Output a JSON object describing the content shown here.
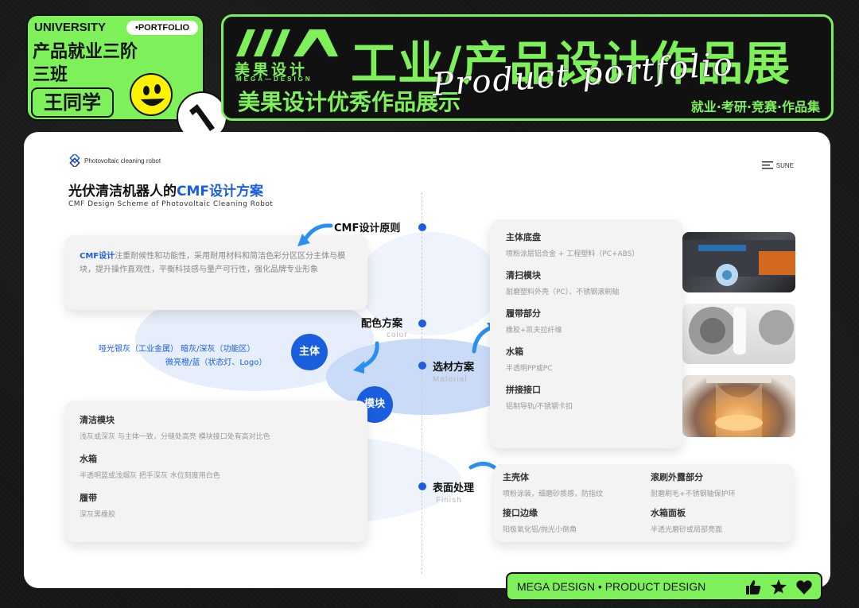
{
  "badge": {
    "university": "UNIVERSITY",
    "portfolio": "•PORTFOLIO",
    "line1": "产品就业三阶",
    "line2": "三班",
    "name": "王同学"
  },
  "banner": {
    "brand_cn": "美果设计",
    "brand_en": "MEGA—DESIGN",
    "title": "工业/产品设计作品展",
    "subtitle": "美果设计优秀作品展示",
    "script": "Product portfolio",
    "tags": "就业·考研·竞赛·作品集"
  },
  "card": {
    "logo_text": "Photovoltaic cleaning robot",
    "sune": "SUNE",
    "title_prefix": "光伏清洁机器人的",
    "title_highlight": "CMF设计方案",
    "subtitle": "CMF Design Scheme of Photovoltaic Cleaning Robot"
  },
  "nodes": {
    "principle": "CMF设计原则",
    "color": "配色方案",
    "color_en": "color",
    "material": "选材方案",
    "material_en": "Material",
    "finish": "表面处理",
    "finish_en": "Finish"
  },
  "intro": {
    "highlight": "CMF设计",
    "text": "注重耐候性和功能性，采用耐用材料和简洁色彩分区区分主体与模块，提升操作直观性，平衡科技感与量产可行性，强化品牌专业形象"
  },
  "circles": {
    "main": "主体",
    "module": "模块"
  },
  "color_scheme": {
    "line1": "哑光银灰（工业金属）   暗灰/深灰（功能区）",
    "line2": "微亮橙/蓝（状态灯、Logo）"
  },
  "module_panel": [
    {
      "title": "清洁模块",
      "desc": "浅灰或深灰     与主体一致，分缝处高亮     模块接口处有高对比色"
    },
    {
      "title": "水箱",
      "desc": "半透明蓝或浅烟灰     把手深灰   水位刻度用白色"
    },
    {
      "title": "履带",
      "desc": "深灰黑橡胶"
    }
  ],
  "material_panel": [
    {
      "title": "主体底盘",
      "desc": "喷粉涂层铝合金 + 工程塑料（PC+ABS）"
    },
    {
      "title": "清扫模块",
      "desc": "耐磨塑料外壳（PC）、不锈钢滚刷轴"
    },
    {
      "title": "履带部分",
      "desc": "橡胶+凯夫拉纤维"
    },
    {
      "title": "水箱",
      "desc": "半透明PP或PC"
    },
    {
      "title": "拼接接口",
      "desc": "铝制导轨/不锈钢卡扣"
    }
  ],
  "finish_panel": [
    {
      "title": "主壳体",
      "desc": "喷粉涂装，细磨砂质感，防指纹"
    },
    {
      "title": "滚刷外露部分",
      "desc": "耐磨刷毛+不锈钢轴保护环"
    },
    {
      "title": "接口边缘",
      "desc": "阳极氧化铝/抛光小倒角"
    },
    {
      "title": "水箱面板",
      "desc": "半透光磨砂或局部亮面"
    }
  ],
  "footer": {
    "text": "MEGA DESIGN • PRODUCT DESIGN"
  },
  "colors": {
    "accent_green": "#7df05a",
    "accent_blue": "#1a5ee0"
  }
}
